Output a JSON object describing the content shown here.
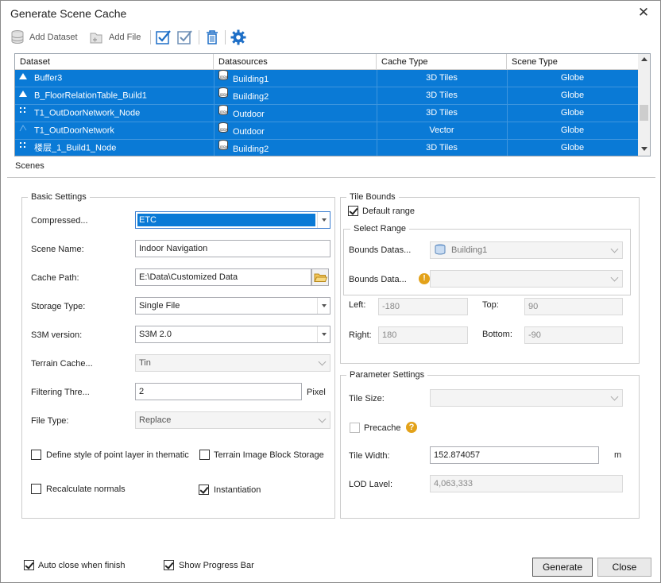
{
  "window": {
    "title": "Generate Scene Cache",
    "close_glyph": "✕"
  },
  "toolbar": {
    "add_dataset": "Add Dataset",
    "add_file": "Add File"
  },
  "grid": {
    "columns": [
      "Dataset",
      "Datasources",
      "Cache Type",
      "Scene Type"
    ],
    "rows": [
      {
        "icon": "triangle-icon",
        "dataset": "Buffer3",
        "datasource": "Building1",
        "cache_type": "3D Tiles",
        "scene_type": "Globe"
      },
      {
        "icon": "triangle-icon",
        "dataset": "B_FloorRelationTable_Build1",
        "datasource": "Building2",
        "cache_type": "3D Tiles",
        "scene_type": "Globe"
      },
      {
        "icon": "dots-icon",
        "dataset": "T1_OutDoorNetwork_Node",
        "datasource": "Outdoor",
        "cache_type": "3D Tiles",
        "scene_type": "Globe"
      },
      {
        "icon": "network-icon",
        "dataset": "T1_OutDoorNetwork",
        "datasource": "Outdoor",
        "cache_type": "Vector",
        "scene_type": "Globe"
      },
      {
        "icon": "dots-icon",
        "dataset": "楼层_1_Build1_Node",
        "datasource": "Building2",
        "cache_type": "3D Tiles",
        "scene_type": "Globe"
      }
    ]
  },
  "tabs": {
    "scenes": "Scenes"
  },
  "basic": {
    "title": "Basic Settings",
    "compressed_label": "Compressed...",
    "compressed_value": "ETC",
    "scene_name_label": "Scene Name:",
    "scene_name_value": "Indoor Navigation",
    "cache_path_label": "Cache Path:",
    "cache_path_value": "E:\\Data\\Customized Data",
    "storage_type_label": "Storage Type:",
    "storage_type_value": "Single File",
    "s3m_label": "S3M version:",
    "s3m_value": "S3M 2.0",
    "terrain_label": "Terrain Cache...",
    "terrain_value": "Tin",
    "filtering_label": "Filtering Thre...",
    "filtering_value": "2",
    "filtering_unit": "Pixel",
    "file_type_label": "File Type:",
    "file_type_value": "Replace",
    "define_style_label": "Define style of point layer in thematic",
    "terrain_block_label": "Terrain Image Block Storage",
    "recalc_label": "Recalculate normals",
    "instantiation_label": "Instantiation"
  },
  "bounds": {
    "title": "Tile Bounds",
    "default_range": "Default range",
    "select_range": "Select Range",
    "bounds_datas_label": "Bounds Datas...",
    "bounds_datas_value": "Building1",
    "bounds_data_label": "Bounds Data...",
    "left_label": "Left:",
    "left_value": "-180",
    "top_label": "Top:",
    "top_value": "90",
    "right_label": "Right:",
    "right_value": "180",
    "bottom_label": "Bottom:",
    "bottom_value": "-90"
  },
  "params": {
    "title": "Parameter Settings",
    "tile_size_label": "Tile Size:",
    "precache_label": "Precache",
    "tile_width_label": "Tile Width:",
    "tile_width_value": "152.874057",
    "tile_width_unit": "m",
    "lod_label": "LOD Lavel:",
    "lod_value": "4,063,333"
  },
  "footer": {
    "auto_close": "Auto close when finish",
    "show_progress": "Show Progress Bar",
    "generate": "Generate",
    "close": "Close"
  },
  "colors": {
    "selection": "#0a7ad6",
    "accent_icon": "#1e6fc7",
    "warning": "#e3a21a"
  }
}
